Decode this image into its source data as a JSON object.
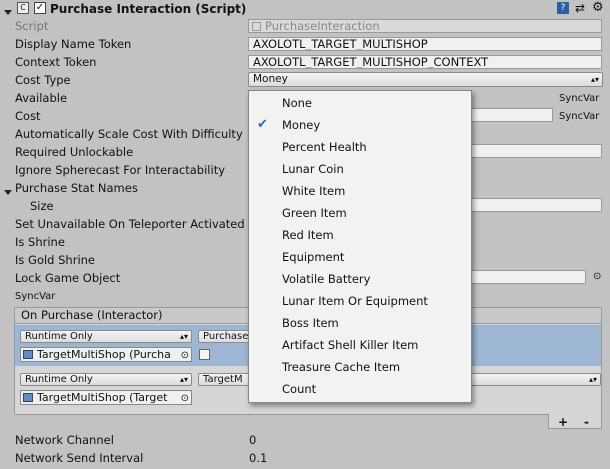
{
  "header": {
    "title": "Purchase Interaction (Script)"
  },
  "script_row": {
    "label": "Script",
    "value": "PurchaseInteraction"
  },
  "fields": {
    "display_name_token": {
      "label": "Display Name Token",
      "value": "AXOLOTL_TARGET_MULTISHOP"
    },
    "context_token": {
      "label": "Context Token",
      "value": "AXOLOTL_TARGET_MULTISHOP_CONTEXT"
    },
    "cost_type": {
      "label": "Cost Type",
      "value": "Money"
    },
    "available": {
      "label": "Available",
      "tag": "SyncVar"
    },
    "cost": {
      "label": "Cost",
      "tag": "SyncVar"
    },
    "auto_scale": {
      "label": "Automatically Scale Cost With Difficulty"
    },
    "required_unlockable": {
      "label": "Required Unlockable"
    },
    "ignore_spherecast": {
      "label": "Ignore Spherecast For Interactability"
    },
    "purchase_stat_names": {
      "label": "Purchase Stat Names"
    },
    "size": {
      "label": "Size"
    },
    "set_unavailable": {
      "label": "Set Unavailable On Teleporter Activated"
    },
    "is_shrine": {
      "label": "Is Shrine"
    },
    "is_gold_shrine": {
      "label": "Is Gold Shrine"
    },
    "lock_game_object": {
      "label": "Lock Game Object"
    },
    "syncvar_label": "SyncVar"
  },
  "event": {
    "title": "On Purchase (Interactor)",
    "rows": [
      {
        "mode": "Runtime Only",
        "function": "Purchase",
        "object": "TargetMultiShop (Purcha"
      },
      {
        "mode": "Runtime Only",
        "function": "TargetM",
        "object": "TargetMultiShop (Target"
      }
    ],
    "add": "+",
    "remove": "-"
  },
  "network": {
    "channel": {
      "label": "Network Channel",
      "value": "0"
    },
    "interval": {
      "label": "Network Send Interval",
      "value": "0.1"
    }
  },
  "menu": {
    "selected": "Money",
    "items": [
      "None",
      "Money",
      "Percent Health",
      "Lunar Coin",
      "White Item",
      "Green Item",
      "Red Item",
      "Equipment",
      "Volatile Battery",
      "Lunar Item Or Equipment",
      "Boss Item",
      "Artifact Shell Killer Item",
      "Treasure Cache Item",
      "Count"
    ]
  },
  "colors": {
    "selection": "#9db6d3",
    "check": "#1a6ad8"
  }
}
